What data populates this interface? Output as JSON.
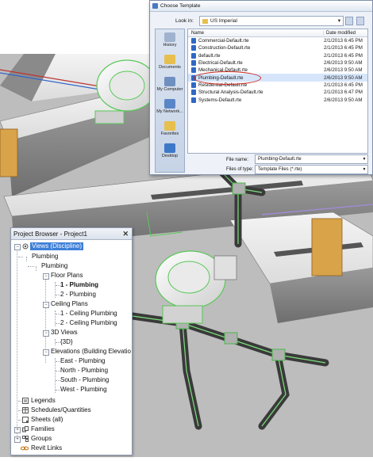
{
  "dialog": {
    "title": "Choose Template",
    "look_in_label": "Look in:",
    "look_in_value": "US Imperial",
    "columns": [
      "Name",
      "Date modified"
    ],
    "places": [
      "History",
      "Documents",
      "My Computer",
      "My Network...",
      "Favorites",
      "Desktop"
    ],
    "files": [
      {
        "name": "Commercial-Default.rte",
        "date": "2/1/2013 6:45 PM"
      },
      {
        "name": "Construction-Default.rte",
        "date": "2/1/2013 6:45 PM"
      },
      {
        "name": "default.rte",
        "date": "2/1/2013 6:45 PM"
      },
      {
        "name": "Electrical-Default.rte",
        "date": "2/6/2013 9:50 AM"
      },
      {
        "name": "Mechanical-Default.rte",
        "date": "2/6/2013 9:50 AM"
      },
      {
        "name": "Plumbing-Default.rte",
        "date": "2/6/2013 9:50 AM"
      },
      {
        "name": "Residential-Default.rte",
        "date": "2/1/2013 6:45 PM"
      },
      {
        "name": "Structural Analysis-Default.rte",
        "date": "2/1/2013 6:47 PM"
      },
      {
        "name": "Systems-Default.rte",
        "date": "2/6/2013 9:50 AM"
      }
    ],
    "file_name_label": "File name:",
    "file_name_value": "Plumbing-Default.rte",
    "files_of_type_label": "Files of type:",
    "files_of_type_value": "Template Files  (*.rte)"
  },
  "project_browser": {
    "title": "Project Browser - Project1",
    "close": "✕",
    "tree": {
      "views": "Views (Discipline)",
      "plumbing": "Plumbing",
      "plumbing_sub": "Plumbing",
      "floor_plans": "Floor Plans",
      "fp1": "1 - Plumbing",
      "fp2": "2 - Plumbing",
      "ceiling_plans": "Ceiling Plans",
      "cp1": "1 - Ceiling Plumbing",
      "cp2": "2 - Ceiling Plumbing",
      "views_3d": "3D Views",
      "v3d": "{3D}",
      "elevations": "Elevations (Building Elevatio",
      "east": "East - Plumbing",
      "north": "North - Plumbing",
      "south": "South - Plumbing",
      "west": "West - Plumbing",
      "legends": "Legends",
      "schedules": "Schedules/Quantities",
      "sheets": "Sheets (all)",
      "families": "Families",
      "groups": "Groups",
      "revit_links": "Revit Links"
    }
  }
}
